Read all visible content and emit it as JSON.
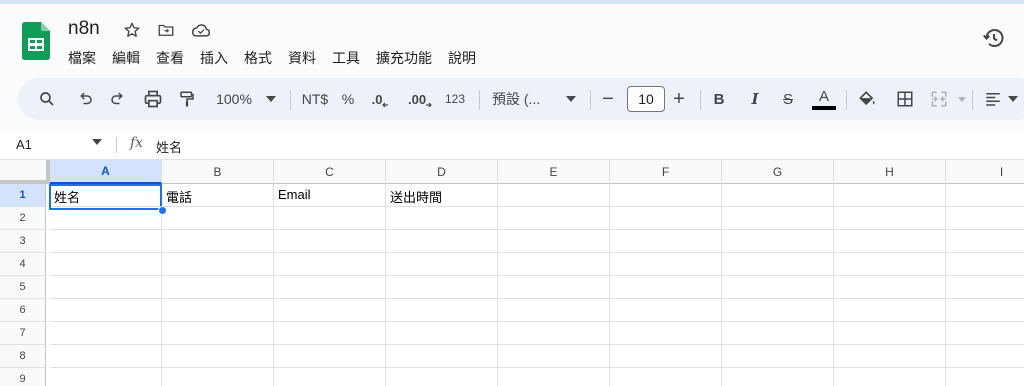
{
  "app": {
    "doc_title": "n8n",
    "icons": {
      "logo": "sheets-logo-icon",
      "star": "star-icon",
      "move": "move-to-folder-icon",
      "cloud": "cloud-status-icon",
      "history": "history-icon"
    }
  },
  "menu": [
    "檔案",
    "編輯",
    "查看",
    "插入",
    "格式",
    "資料",
    "工具",
    "擴充功能",
    "說明"
  ],
  "toolbar": {
    "zoom": "100%",
    "currency": "NT$",
    "percent": "%",
    "decrease_decimal": ".0",
    "increase_decimal": ".00",
    "more_formats": "123",
    "font": "預設 (...",
    "font_size": "10",
    "minus": "−",
    "plus": "+",
    "bold": "B",
    "italic": "I",
    "strike": "S",
    "text_color_label": "A",
    "colors": {
      "text_color_bar": "#000000",
      "accent": "#0b57d0"
    }
  },
  "formula_bar": {
    "name_box": "A1",
    "fx": "fx",
    "content": "姓名"
  },
  "sheet": {
    "columns": [
      "A",
      "B",
      "C",
      "D",
      "E",
      "F",
      "G",
      "H",
      "I"
    ],
    "rows": [
      "1",
      "2",
      "3",
      "4",
      "5",
      "6",
      "7",
      "8",
      "9"
    ],
    "row1": [
      "姓名",
      "電話",
      "Email",
      "送出時間",
      "",
      "",
      "",
      "",
      ""
    ],
    "active_cell": "A1"
  }
}
